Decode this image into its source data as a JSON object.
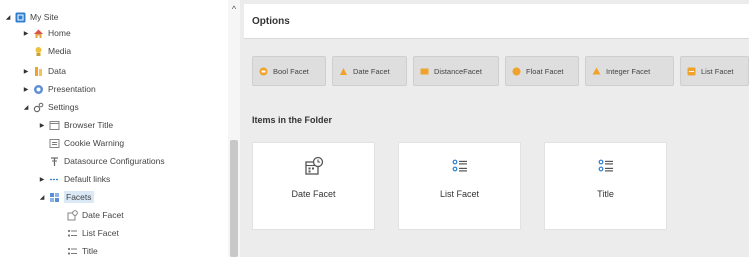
{
  "tree": {
    "items": [
      {
        "label": "My Site",
        "toggle": "expanded",
        "icon": "site-icon"
      },
      {
        "label": "Home",
        "toggle": "collapsed",
        "icon": "home-icon"
      },
      {
        "label": "Media",
        "toggle": "none",
        "icon": "media-icon"
      },
      {
        "label": "Data",
        "toggle": "collapsed",
        "icon": "data-icon"
      },
      {
        "label": "Presentation",
        "toggle": "collapsed",
        "icon": "presentation-icon"
      },
      {
        "label": "Settings",
        "toggle": "expanded",
        "icon": "settings-icon"
      },
      {
        "label": "Browser Title",
        "toggle": "collapsed",
        "icon": "browser-title-icon"
      },
      {
        "label": "Cookie Warning",
        "toggle": "none",
        "icon": "cookie-warning-icon"
      },
      {
        "label": "Datasource Configurations",
        "toggle": "none",
        "icon": "datasource-icon"
      },
      {
        "label": "Default links",
        "toggle": "collapsed",
        "icon": "links-icon"
      },
      {
        "label": "Facets",
        "toggle": "expanded",
        "icon": "facets-icon",
        "selected": true
      },
      {
        "label": "Date Facet",
        "toggle": "none",
        "icon": "date-facet-icon"
      },
      {
        "label": "List Facet",
        "toggle": "none",
        "icon": "list-facet-icon"
      },
      {
        "label": "Title",
        "toggle": "none",
        "icon": "title-facet-icon"
      }
    ]
  },
  "options": {
    "title": "Options",
    "buttons": [
      {
        "label": "Bool Facet"
      },
      {
        "label": "Date Facet"
      },
      {
        "label": "DistanceFacet"
      },
      {
        "label": "Float Facet"
      },
      {
        "label": "Integer Facet"
      },
      {
        "label": "List Facet"
      }
    ]
  },
  "items_in_folder": {
    "title": "Items in the Folder",
    "cards": [
      {
        "label": "Date Facet",
        "icon": "calendar-clock-icon"
      },
      {
        "label": "List Facet",
        "icon": "list-icon"
      },
      {
        "label": "Title",
        "icon": "list-icon"
      }
    ]
  },
  "colors": {
    "selected_bg": "#dbe9f7",
    "panel_bg": "#ececec",
    "button_bg": "#dedede",
    "facet_orange": "#f0a22a"
  }
}
